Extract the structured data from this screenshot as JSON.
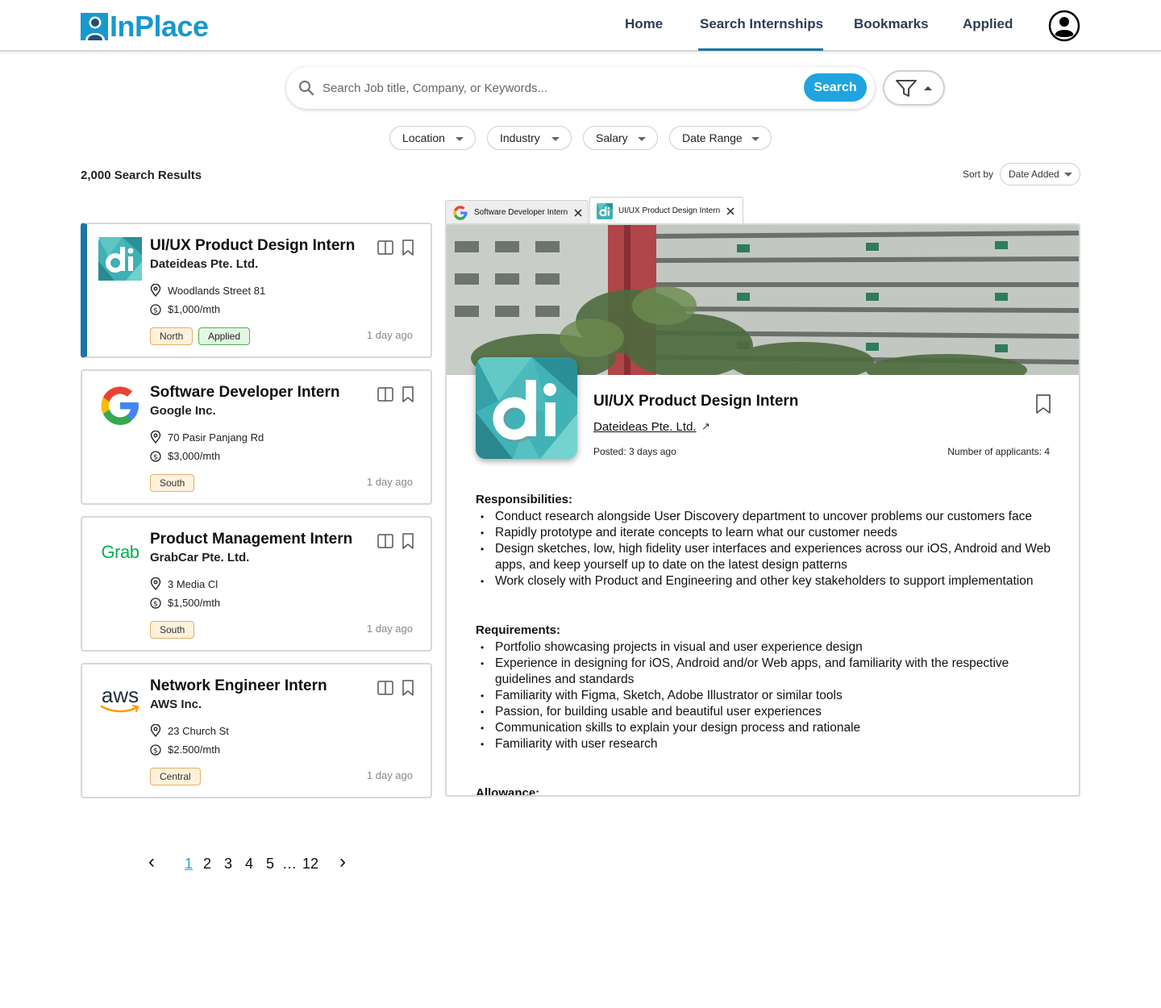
{
  "header": {
    "logo_text": "InPlace",
    "nav": [
      {
        "label": "Home"
      },
      {
        "label": "Search Internships"
      },
      {
        "label": "Bookmarks"
      },
      {
        "label": "Applied"
      }
    ],
    "active_nav": "Search Internships",
    "avatar_icon": "user-circle-icon"
  },
  "search": {
    "placeholder": "Search Job title, Company, or Keywords...",
    "value": "",
    "button_label": "Search",
    "filter_icon": "funnel-icon"
  },
  "filters": [
    {
      "label": "Location"
    },
    {
      "label": "Industry"
    },
    {
      "label": "Salary"
    },
    {
      "label": "Date Range"
    }
  ],
  "results": {
    "count_label": "2,000 Search Results",
    "sort_label": "Sort by",
    "sort_value": "Date Added"
  },
  "cards": [
    {
      "title": "UI/UX Product Design Intern",
      "company": "Dateideas Pte. Ltd.",
      "location": "Woodlands Street 81",
      "salary": "$1,000/mth",
      "region": "North",
      "status": "Applied",
      "posted": "1 day ago",
      "logo": "dateideas-logo"
    },
    {
      "title": "Software Developer Intern",
      "company": "Google Inc.",
      "location": "70 Pasir Panjang Rd",
      "salary": "$3,000/mth",
      "region": "South",
      "posted": "1 day ago",
      "logo": "google-logo"
    },
    {
      "title": "Product Management Intern",
      "company": "GrabCar Pte. Ltd.",
      "location": "3 Media Cl",
      "salary": "$1,500/mth",
      "region": "South",
      "posted": "1 day ago",
      "logo": "grab-logo",
      "logo_text": "Grab"
    },
    {
      "title": "Network Engineer Intern",
      "company": "AWS Inc.",
      "location": "23 Church St",
      "salary": "$2.500/mth",
      "region": "Central",
      "posted": "1 day ago",
      "logo": "aws-logo",
      "logo_text": "aws"
    }
  ],
  "tabs": [
    {
      "label": "Software Developer Intern"
    },
    {
      "label": "UI/UX Product Design Intern"
    }
  ],
  "detail": {
    "title": "UI/UX Product Design Intern",
    "company": "Dateideas Pte. Ltd.",
    "ext_link": "↗",
    "posted": "Posted: 3 days ago",
    "applicants": "Number of applicants: 4",
    "logo_text": "di",
    "responsibilities_title": "Responsibilities:",
    "responsibilities": [
      "Conduct research alongside User Discovery department to uncover problems our customers face",
      "Rapidly prototype and iterate concepts to learn what our customer needs",
      "Design sketches, low, high fidelity user interfaces and experiences across our iOS, Android and Web apps, and keep yourself up to date on the latest design patterns",
      "Work closely with Product and Engineering and other key stakeholders to support implementation"
    ],
    "requirements_title": "Requirements:",
    "requirements": [
      "Portfolio showcasing projects in visual and user experience design",
      "Experience in designing for iOS, Android and/or Web apps, and familiarity with the respective guidelines and standards",
      "Familiarity with Figma, Sketch, Adobe Illustrator or similar tools",
      "Passion, for building usable and beautiful user experiences",
      "Communication skills to explain your design process and rationale",
      "Familiarity with user research"
    ],
    "allowance_title": "Allowance:"
  },
  "pagination": {
    "prev": "‹",
    "next": "›",
    "pages": [
      "1",
      "2",
      "3",
      "4",
      "5"
    ],
    "ellipsis": "…",
    "last": "12",
    "current": "1"
  },
  "colors": {
    "brand": "#1798cf",
    "accent": "#1fa4e0",
    "active_border": "#1976a8"
  }
}
